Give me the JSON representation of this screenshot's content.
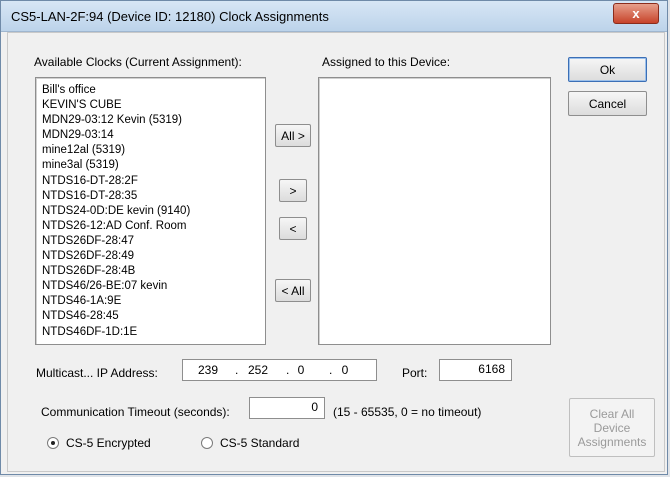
{
  "window": {
    "title": "CS5-LAN-2F:94 (Device ID: 12180) Clock Assignments",
    "close_glyph": "x"
  },
  "available": {
    "label": "Available Clocks (Current Assignment):",
    "items": [
      "Bill's office",
      "KEVIN'S CUBE",
      "MDN29-03:12 Kevin (5319)",
      "MDN29-03:14",
      "mine12al (5319)",
      "mine3al (5319)",
      "NTDS16-DT-28:2F",
      "NTDS16-DT-28:35",
      "NTDS24-0D:DE kevin (9140)",
      "NTDS26-12:AD Conf. Room",
      "NTDS26DF-28:47",
      "NTDS26DF-28:49",
      "NTDS26DF-28:4B",
      "NTDS46/26-BE:07 kevin",
      "NTDS46-1A:9E",
      "NTDS46-28:45",
      "NTDS46DF-1D:1E"
    ]
  },
  "assigned": {
    "label": "Assigned to this Device:",
    "items": []
  },
  "transfer": {
    "all_right": "All >",
    "right": ">",
    "left": "<",
    "all_left": "< All"
  },
  "buttons": {
    "ok": "Ok",
    "cancel": "Cancel",
    "clear_all": [
      "Clear All",
      "Device",
      "Assignments"
    ]
  },
  "multicast": {
    "label": "Multicast...  IP Address:",
    "ip": [
      "239",
      "252",
      "0",
      "0"
    ],
    "port_label": "Port:",
    "port": "6168"
  },
  "timeout": {
    "label": "Communication Timeout (seconds):",
    "value": "0",
    "hint": "(15 - 65535, 0 = no timeout)"
  },
  "encryption": {
    "options": [
      {
        "label": "CS-5 Encrypted",
        "checked": true
      },
      {
        "label": "CS-5 Standard",
        "checked": false
      }
    ]
  }
}
